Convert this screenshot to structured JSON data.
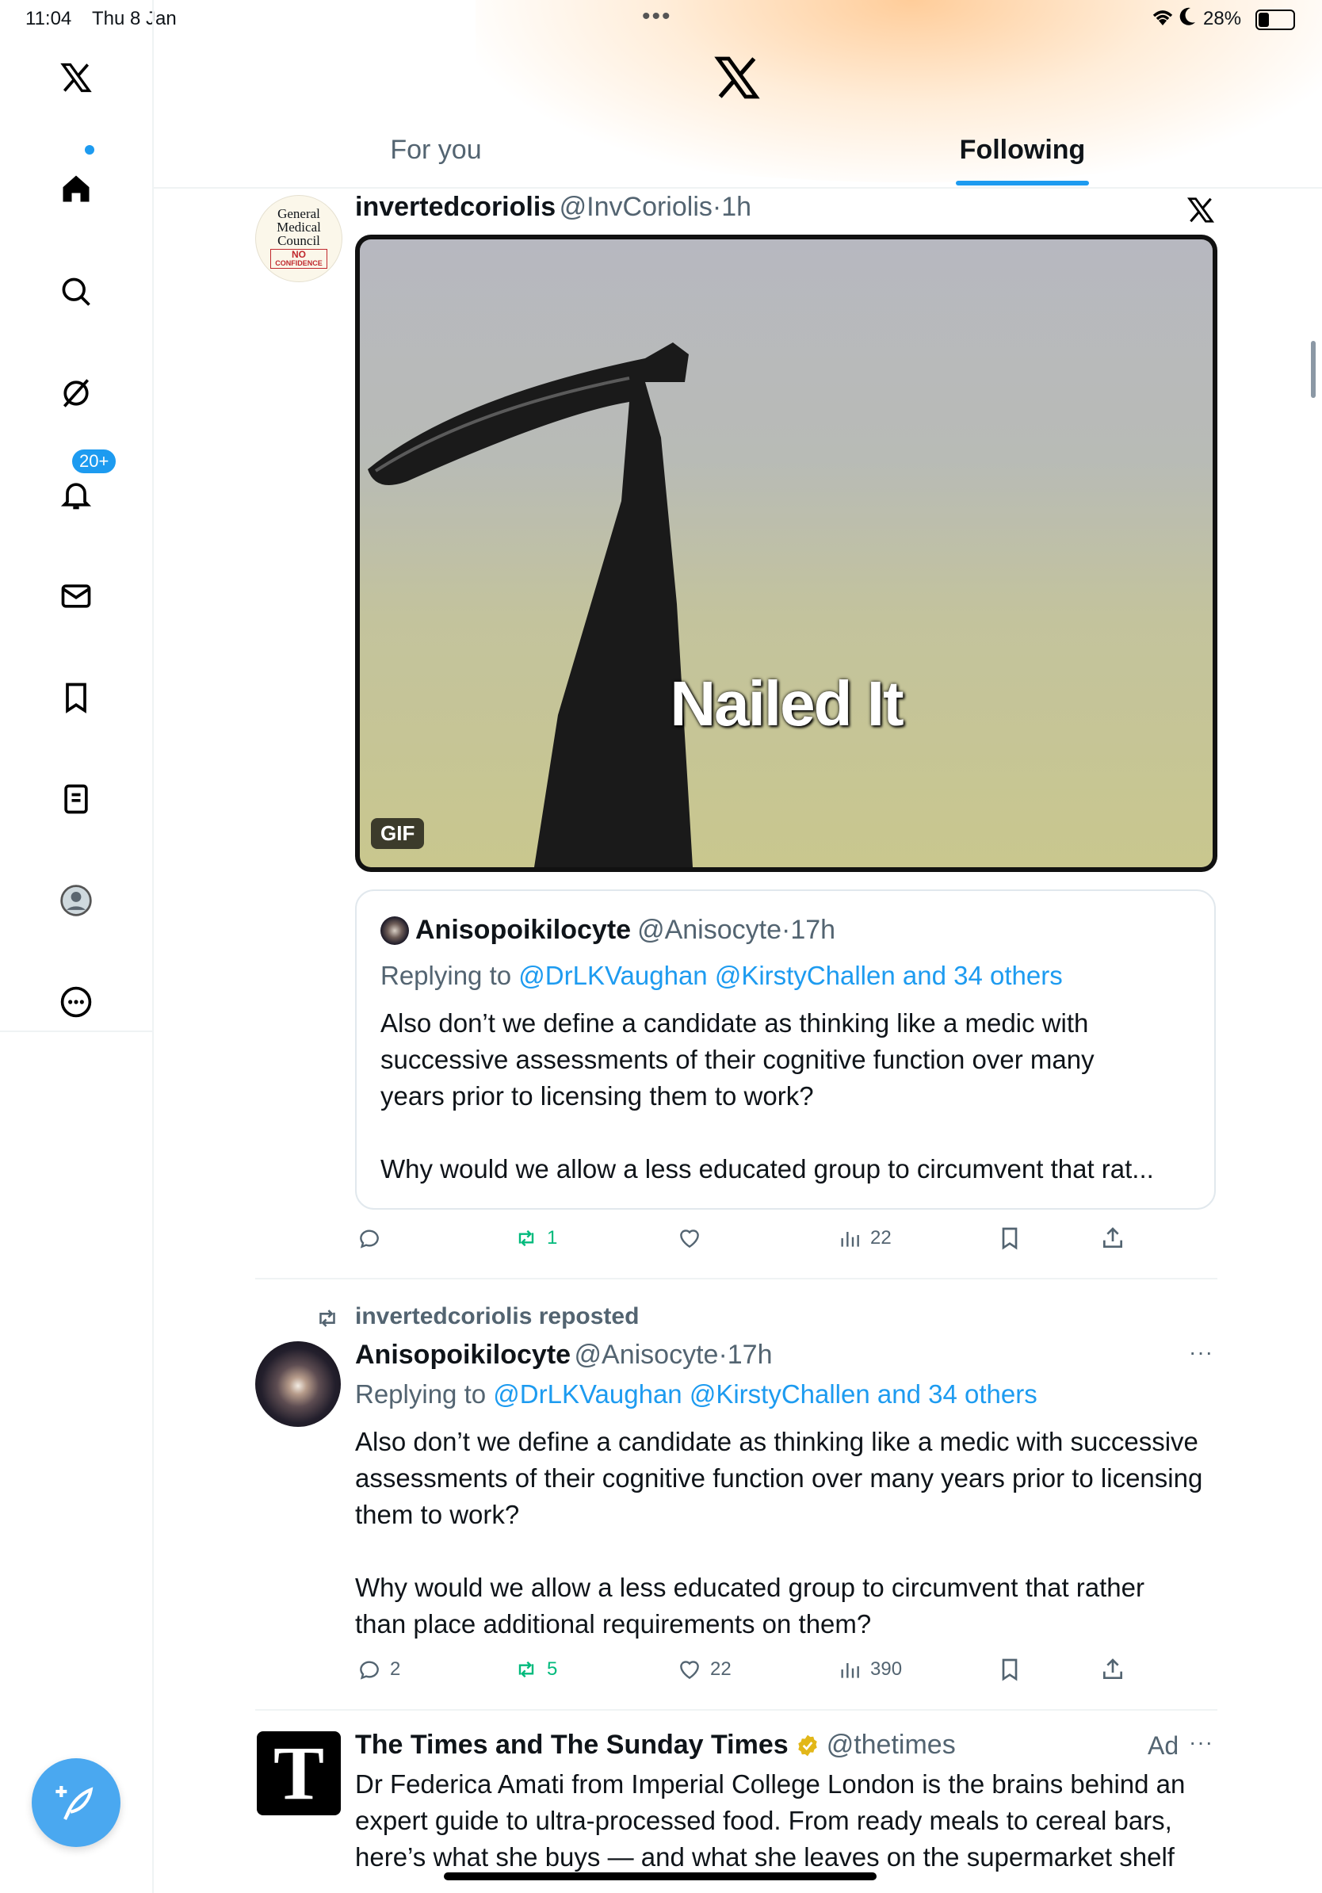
{
  "status_bar": {
    "time": "11:04",
    "date": "Thu 8 Jan",
    "battery": "28%"
  },
  "header": {
    "tabs": [
      {
        "label": "For you"
      },
      {
        "label": "Following"
      }
    ]
  },
  "sidebar": {
    "notifications_badge": "20+"
  },
  "tweet1": {
    "avatar_text": [
      "General",
      "Medical",
      "Council",
      "NO",
      "CONFIDENCE"
    ],
    "name": "invertedcoriolis",
    "handle": "@InvCoriolis",
    "time": "1h",
    "media": {
      "caption": "Nailed It",
      "badge": "GIF"
    },
    "quote": {
      "name": "Anisopoikilocyte",
      "handle": "@Anisocyte",
      "time": "17h",
      "replying_prefix": "Replying to",
      "replying_to": "@DrLKVaughan @KirstyChallen and 34 others",
      "text1": "Also don’t we define a candidate as thinking like a medic with successive assessments of their cognitive function over many years prior to licensing them to work?",
      "text2": "Why would we allow a less educated group to circumvent that rat..."
    },
    "stats": {
      "replies": "",
      "reposts": "1",
      "likes": "",
      "views": "22"
    }
  },
  "tweet2": {
    "repost_label": "invertedcoriolis reposted",
    "name": "Anisopoikilocyte",
    "handle": "@Anisocyte",
    "time": "17h",
    "replying_prefix": "Replying to",
    "replying_to": "@DrLKVaughan @KirstyChallen and 34 others",
    "text1": "Also don’t we define a candidate as thinking like a medic with successive assessments of their cognitive function over many years prior to licensing them to work?",
    "text2": "Why would we allow a less educated group to circumvent that rather than place additional requirements on them?",
    "stats": {
      "replies": "2",
      "reposts": "5",
      "likes": "22",
      "views": "390"
    }
  },
  "tweet3": {
    "avatar_letter": "T",
    "name": "The Times and The Sunday Times",
    "handle": "@thetimes",
    "ad_label": "Ad",
    "text": "Dr Federica Amati from Imperial College London is the brains behind an expert guide to ultra-processed food. From ready meals to cereal bars, here’s what she buys — and what she leaves on the supermarket shelf"
  },
  "colors": {
    "accent": "#1d9bf0",
    "repost_green": "#00ba7c",
    "text": "#0f1419",
    "muted": "#536471"
  },
  "icons": [
    "x-logo-icon",
    "home-icon",
    "search-icon",
    "grok-icon",
    "bell-icon",
    "mail-icon",
    "bookmark-icon",
    "lists-icon",
    "profile-icon",
    "more-icon",
    "compose-icon",
    "reply-icon",
    "repost-icon",
    "like-icon",
    "views-icon",
    "share-icon",
    "verified-icon"
  ]
}
